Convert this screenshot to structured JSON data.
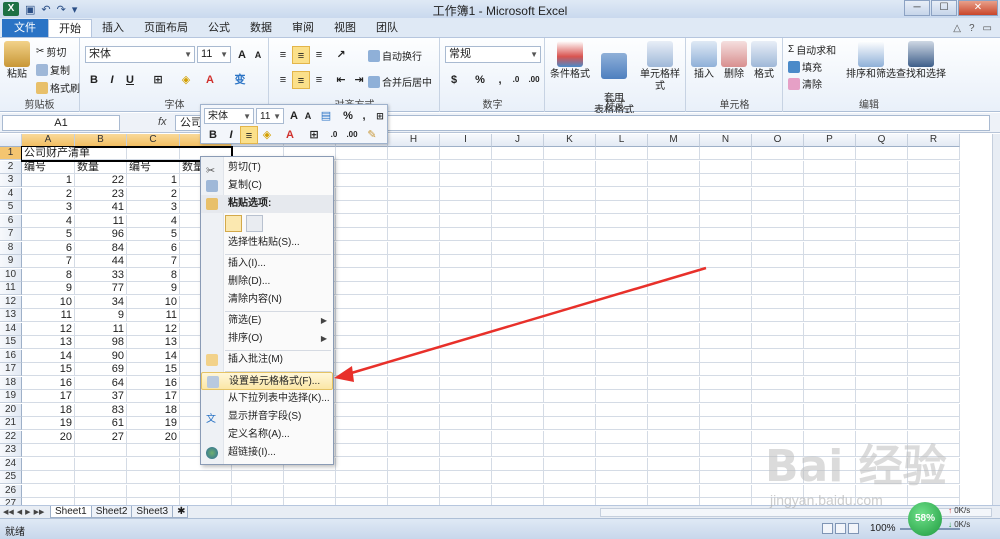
{
  "window": {
    "title": "工作簿1 - Microsoft Excel",
    "min": "─",
    "max": "☐",
    "close": "✕"
  },
  "tabs": [
    {
      "label": "文件"
    },
    {
      "label": "开始"
    },
    {
      "label": "插入"
    },
    {
      "label": "页面布局"
    },
    {
      "label": "公式"
    },
    {
      "label": "数据"
    },
    {
      "label": "审阅"
    },
    {
      "label": "视图"
    },
    {
      "label": "团队"
    }
  ],
  "ribbon": {
    "clipboard": {
      "label": "剪贴板",
      "paste": "粘贴",
      "cut": "剪切",
      "copy": "复制",
      "painter": "格式刷"
    },
    "font": {
      "label": "字体",
      "name": "宋体",
      "size": "11",
      "bold": "B",
      "italic": "I",
      "underline": "U",
      "grow": "A",
      "shrink": "A",
      "wen": "变"
    },
    "align": {
      "label": "对齐方式",
      "wrap": "自动换行",
      "merge": "合并后居中"
    },
    "number": {
      "label": "数字",
      "format": "常规",
      "percent": "%",
      "comma": ","
    },
    "styles": {
      "label": "样式",
      "cond": "条件格式",
      "table": "套用\n表格格式",
      "cell": "单元格样式"
    },
    "cells": {
      "label": "单元格",
      "insert": "插入",
      "delete": "删除",
      "format": "格式"
    },
    "edit": {
      "label": "编辑",
      "autosum": "自动求和",
      "fill": "填充",
      "clear": "清除",
      "sort": "排序和筛选",
      "find": "查找和选择"
    }
  },
  "formula_bar": {
    "namebox": "A1",
    "fx": "fx",
    "content": "公司财产清单"
  },
  "grid": {
    "columns": [
      "A",
      "B",
      "C",
      "D",
      "E",
      "F",
      "G",
      "H",
      "I",
      "J",
      "K",
      "L",
      "M",
      "N",
      "O",
      "P",
      "Q",
      "R"
    ],
    "title": "公司财产清单",
    "headers": [
      "编号",
      "数量",
      "编号",
      "数量"
    ],
    "rows": [
      [
        1,
        22,
        1
      ],
      [
        2,
        23,
        2
      ],
      [
        3,
        41,
        3
      ],
      [
        4,
        11,
        4
      ],
      [
        5,
        96,
        5
      ],
      [
        6,
        84,
        6
      ],
      [
        7,
        44,
        7
      ],
      [
        8,
        33,
        8
      ],
      [
        9,
        77,
        9
      ],
      [
        10,
        34,
        10
      ],
      [
        11,
        9,
        11
      ],
      [
        12,
        11,
        12
      ],
      [
        13,
        98,
        13
      ],
      [
        14,
        90,
        14
      ],
      [
        15,
        69,
        15
      ],
      [
        16,
        64,
        16
      ],
      [
        17,
        37,
        17
      ],
      [
        18,
        83,
        18
      ],
      [
        19,
        61,
        19
      ],
      [
        20,
        27,
        20
      ]
    ],
    "row_count": 27
  },
  "mini_toolbar": {
    "font": "宋体",
    "size": "11",
    "bold": "B",
    "italic": "I"
  },
  "context_menu": {
    "items": [
      {
        "label": "剪切(T)"
      },
      {
        "label": "复制(C)"
      },
      {
        "label": "粘贴选项:"
      },
      {
        "label": "选择性粘贴(S)..."
      },
      {
        "label": "插入(I)..."
      },
      {
        "label": "删除(D)..."
      },
      {
        "label": "清除内容(N)"
      },
      {
        "label": "筛选(E)"
      },
      {
        "label": "排序(O)"
      },
      {
        "label": "插入批注(M)"
      },
      {
        "label": "设置单元格格式(F)..."
      },
      {
        "label": "从下拉列表中选择(K)..."
      },
      {
        "label": "显示拼音字段(S)"
      },
      {
        "label": "定义名称(A)..."
      },
      {
        "label": "超链接(I)..."
      }
    ]
  },
  "sheets": [
    {
      "name": "Sheet1"
    },
    {
      "name": "Sheet2"
    },
    {
      "name": "Sheet3"
    }
  ],
  "status": {
    "ready": "就绪",
    "zoom": "100%"
  },
  "net": {
    "percent": "58%",
    "up": "0K/s",
    "down": "0K/s"
  },
  "watermark": {
    "text": "Bai 经验",
    "url": "jingyan.baidu.com"
  },
  "colors": {
    "accent": "#2a73c5",
    "arrow": "#e8302a",
    "highlight": "#fbe7a6"
  }
}
